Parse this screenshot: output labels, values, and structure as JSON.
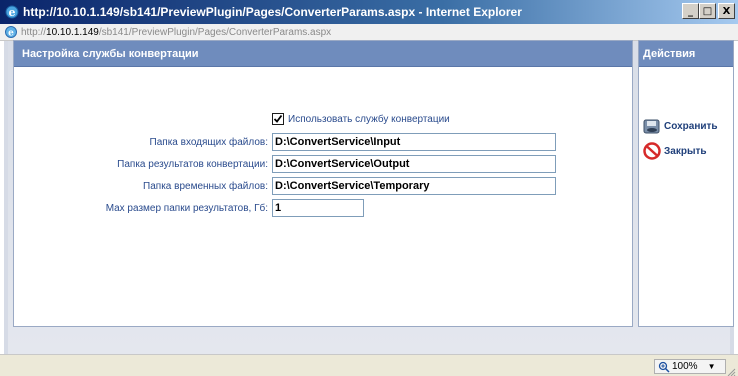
{
  "window": {
    "title": "http://10.10.1.149/sb141/PreviewPlugin/Pages/ConverterParams.aspx - Internet Explorer",
    "min_label": "_",
    "max_label": "□",
    "close_label": "X"
  },
  "address": {
    "prefix": "http://",
    "host": "10.10.1.149",
    "path": "/sb141/PreviewPlugin/Pages/ConverterParams.aspx"
  },
  "main_panel": {
    "header": "Настройка службы конвертации",
    "use_service": {
      "label": "Использовать службу конвертации",
      "checked": true
    },
    "fields": [
      {
        "label": "Папка входящих файлов:",
        "value": "D:\\ConvertService\\Input"
      },
      {
        "label": "Папка результатов конвертации:",
        "value": "D:\\ConvertService\\Output"
      },
      {
        "label": "Папка временных файлов:",
        "value": "D:\\ConvertService\\Temporary"
      },
      {
        "label": "Max размер папки результатов, Гб:",
        "value": "1"
      }
    ]
  },
  "actions_panel": {
    "header": "Действия",
    "save_label": "Сохранить",
    "close_label": "Закрыть"
  },
  "statusbar": {
    "zoom": "100%"
  },
  "colors": {
    "panel_header": "#6f8cbd",
    "label_text": "#2a4b8d",
    "titlebar_start": "#0a246a"
  }
}
